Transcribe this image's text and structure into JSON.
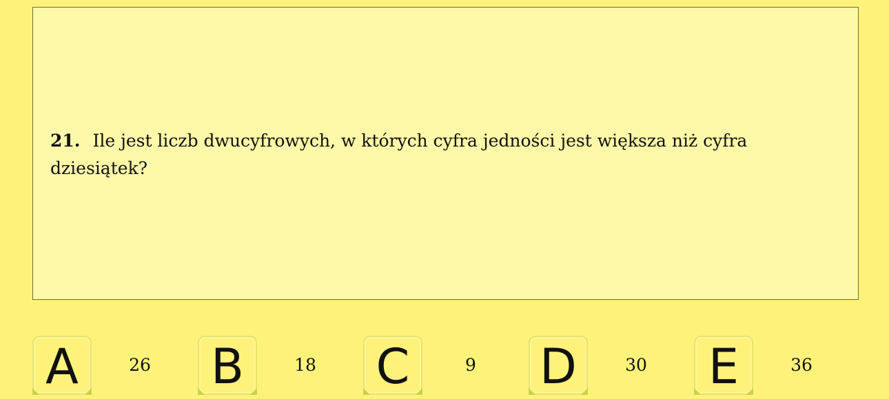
{
  "question": {
    "number": "21.",
    "text": "Ile jest liczb dwucyfrowych, w których cyfra jedności jest większa niż cyfra dziesiątek?"
  },
  "answers": [
    {
      "letter": "A",
      "value": "26"
    },
    {
      "letter": "B",
      "value": "18"
    },
    {
      "letter": "C",
      "value": "9"
    },
    {
      "letter": "D",
      "value": "30"
    },
    {
      "letter": "E",
      "value": "36"
    }
  ],
  "colors": {
    "page_background": "#fff27a",
    "question_background": "#fdf9a8",
    "border": "#6f6b3a"
  }
}
